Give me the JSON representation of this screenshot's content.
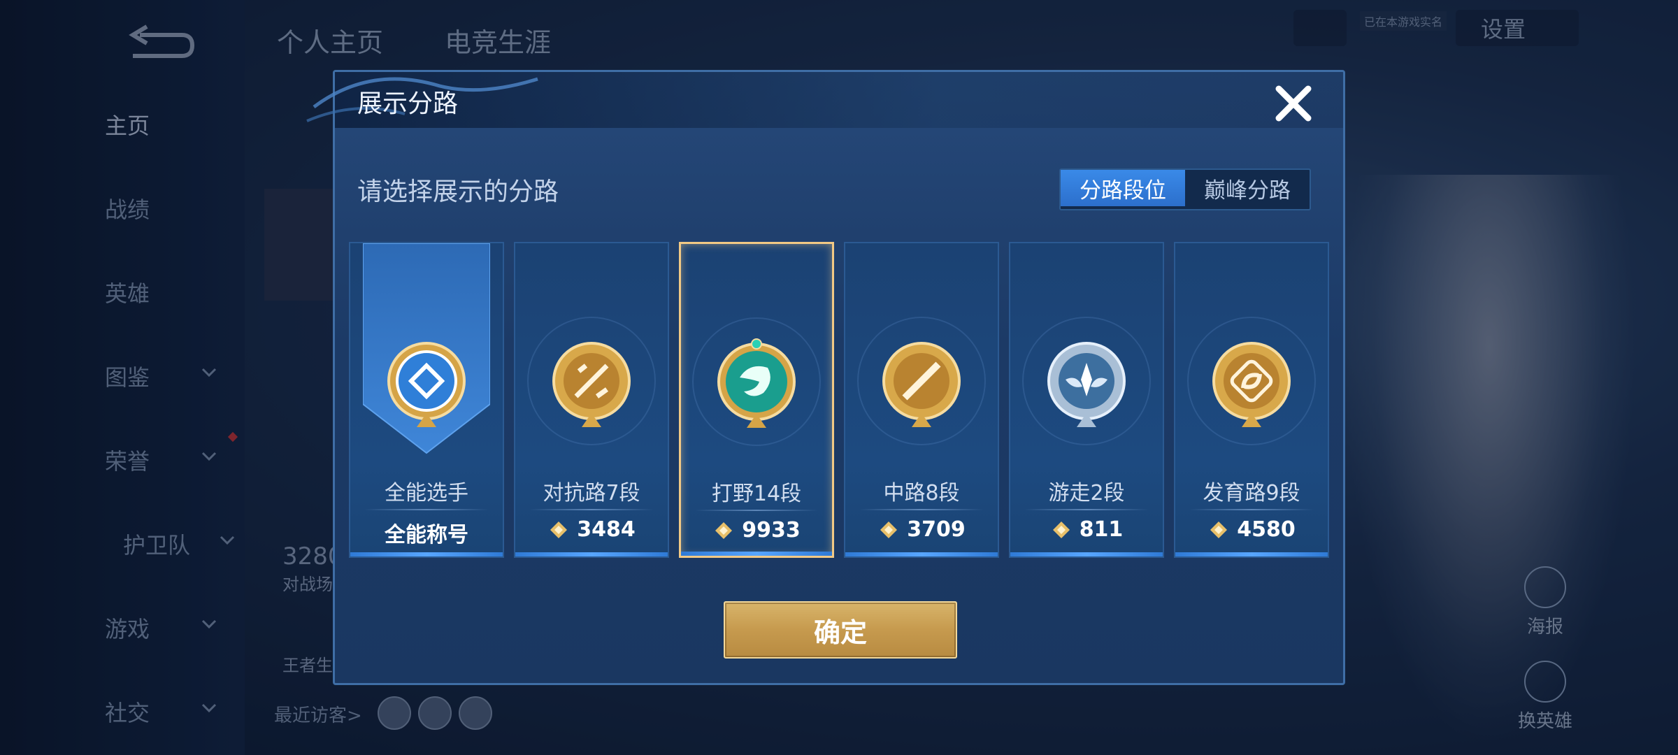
{
  "background": {
    "nav": [
      {
        "label": "主页",
        "active": true
      },
      {
        "label": "战绩"
      },
      {
        "label": "英雄"
      },
      {
        "label": "图鉴",
        "chevron": true
      },
      {
        "label": "荣誉",
        "chevron": true,
        "dot": true
      },
      {
        "label": "护卫队",
        "chevron": true
      },
      {
        "label": "游戏",
        "chevron": true
      },
      {
        "label": "社交",
        "chevron": true
      }
    ],
    "tabs": [
      "个人主页",
      "电竞生涯"
    ],
    "settings_label": "设置",
    "mini_tag": "已在本游戏实名",
    "stat_value": "3280",
    "stat_label": "对战场",
    "stat2_label": "王者生",
    "visitors_label": "最近访客>",
    "right_actions": [
      "海报",
      "换英雄"
    ]
  },
  "modal": {
    "title": "展示分路",
    "subtitle": "请选择展示的分路",
    "segments": [
      "分路段位",
      "巅峰分路"
    ],
    "active_segment": 0,
    "confirm_label": "确定",
    "cards": [
      {
        "name": "全能选手",
        "value": "全能称号",
        "type": "banner"
      },
      {
        "name": "对抗路7段",
        "value": "3484",
        "type": "gold"
      },
      {
        "name": "打野14段",
        "value": "9933",
        "type": "teal",
        "selected": true
      },
      {
        "name": "中路8段",
        "value": "3709",
        "type": "gold"
      },
      {
        "name": "游走2段",
        "value": "811",
        "type": "silver"
      },
      {
        "name": "发育路9段",
        "value": "4580",
        "type": "gold"
      }
    ]
  },
  "colors": {
    "accent_gold": "#f2c985",
    "segment_active": "#3a8ae8",
    "modal_bg": "#1c3a66"
  }
}
